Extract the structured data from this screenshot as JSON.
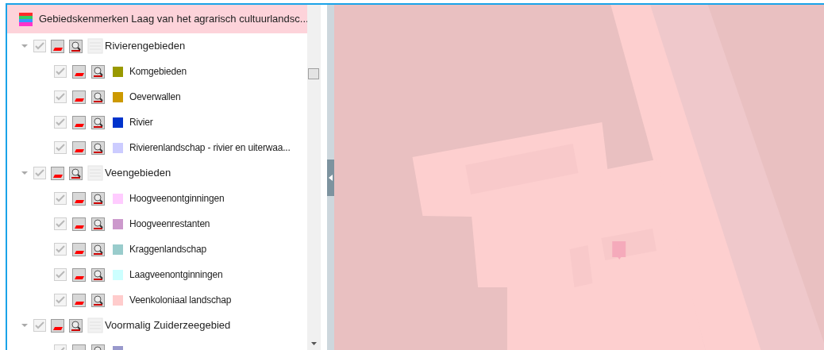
{
  "layer": {
    "title": "Gebiedskenmerken Laag van het agrarisch cultuurlandsc...",
    "expanded": true
  },
  "groups": [
    {
      "label": "Rivierengebieden",
      "expanded": true,
      "checked": true,
      "children": [
        {
          "label": "Komgebieden",
          "checked": true,
          "color": "#999900"
        },
        {
          "label": "Oeverwallen",
          "checked": true,
          "color": "#cc9900"
        },
        {
          "label": "Rivier",
          "checked": true,
          "color": "#0033cc"
        },
        {
          "label": "Rivierenlandschap - rivier en uiterwaa...",
          "checked": true,
          "color": "#ccccff"
        }
      ]
    },
    {
      "label": "Veengebieden",
      "expanded": true,
      "checked": true,
      "children": [
        {
          "label": "Hoogveenontginningen",
          "checked": true,
          "color": "#ffccff"
        },
        {
          "label": "Hoogveenrestanten",
          "checked": true,
          "color": "#cc99cc"
        },
        {
          "label": "Kraggenlandschap",
          "checked": true,
          "color": "#99cccc"
        },
        {
          "label": "Laagveenontginningen",
          "checked": true,
          "color": "#ccffff"
        },
        {
          "label": "Veenkoloniaal landschap",
          "checked": true,
          "color": "#ffcccc"
        }
      ]
    },
    {
      "label": "Voormalig Zuiderzeegebied",
      "expanded": true,
      "checked": true,
      "children": [
        {
          "checked": true,
          "color": "#9999cc"
        }
      ]
    }
  ]
}
